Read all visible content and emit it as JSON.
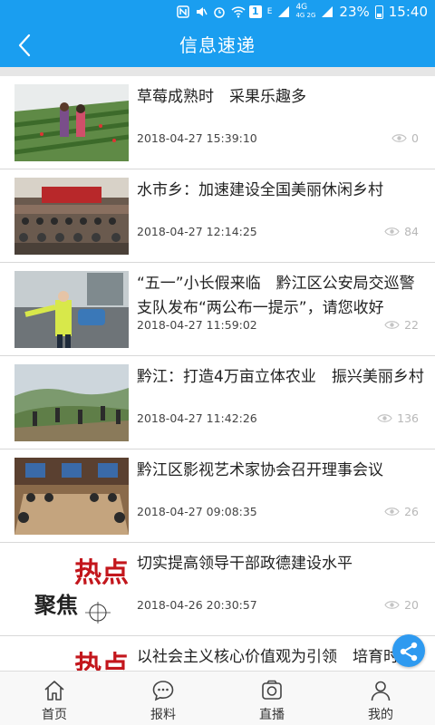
{
  "statusbar": {
    "network_top": "4G",
    "network_bottom": "4G 2G",
    "battery": "23%",
    "time": "15:40",
    "notification_count": "1",
    "edge_label": "E",
    "color": "#1a9ef0"
  },
  "header": {
    "title": "信息速递",
    "back_icon": "chevron-left-icon",
    "color": "#1a9ef0"
  },
  "news": [
    {
      "title": "草莓成熟时　采果乐趣多",
      "time": "2018-04-27 15:39:10",
      "views": "0"
    },
    {
      "title": "水市乡：加速建设全国美丽休闲乡村",
      "time": "2018-04-27 12:14:25",
      "views": "84"
    },
    {
      "title": "“五一”小长假来临　黔江区公安局交巡警支队发布“两公布一提示”，请您收好",
      "time": "2018-04-27 11:59:02",
      "views": "22"
    },
    {
      "title": "黔江：打造4万亩立体农业　振兴美丽乡村",
      "time": "2018-04-27 11:42:26",
      "views": "136"
    },
    {
      "title": "黔江区影视艺术家协会召开理事会议",
      "time": "2018-04-27 09:08:35",
      "views": "26"
    },
    {
      "title": "切实提高领导干部政德建设水平",
      "time": "2018-04-26 20:30:57",
      "views": "20"
    },
    {
      "title": "以社会主义核心价值观为引领　培育时代重庆人文精神",
      "time": "",
      "views": ""
    }
  ],
  "thumb_logo": {
    "top": "热点",
    "bottom": "聚焦"
  },
  "fab_icon": "share-icon",
  "nav": [
    {
      "label": "首页",
      "icon": "home-icon"
    },
    {
      "label": "报料",
      "icon": "chat-bubble-icon"
    },
    {
      "label": "直播",
      "icon": "camera-icon"
    },
    {
      "label": "我的",
      "icon": "user-icon"
    }
  ]
}
